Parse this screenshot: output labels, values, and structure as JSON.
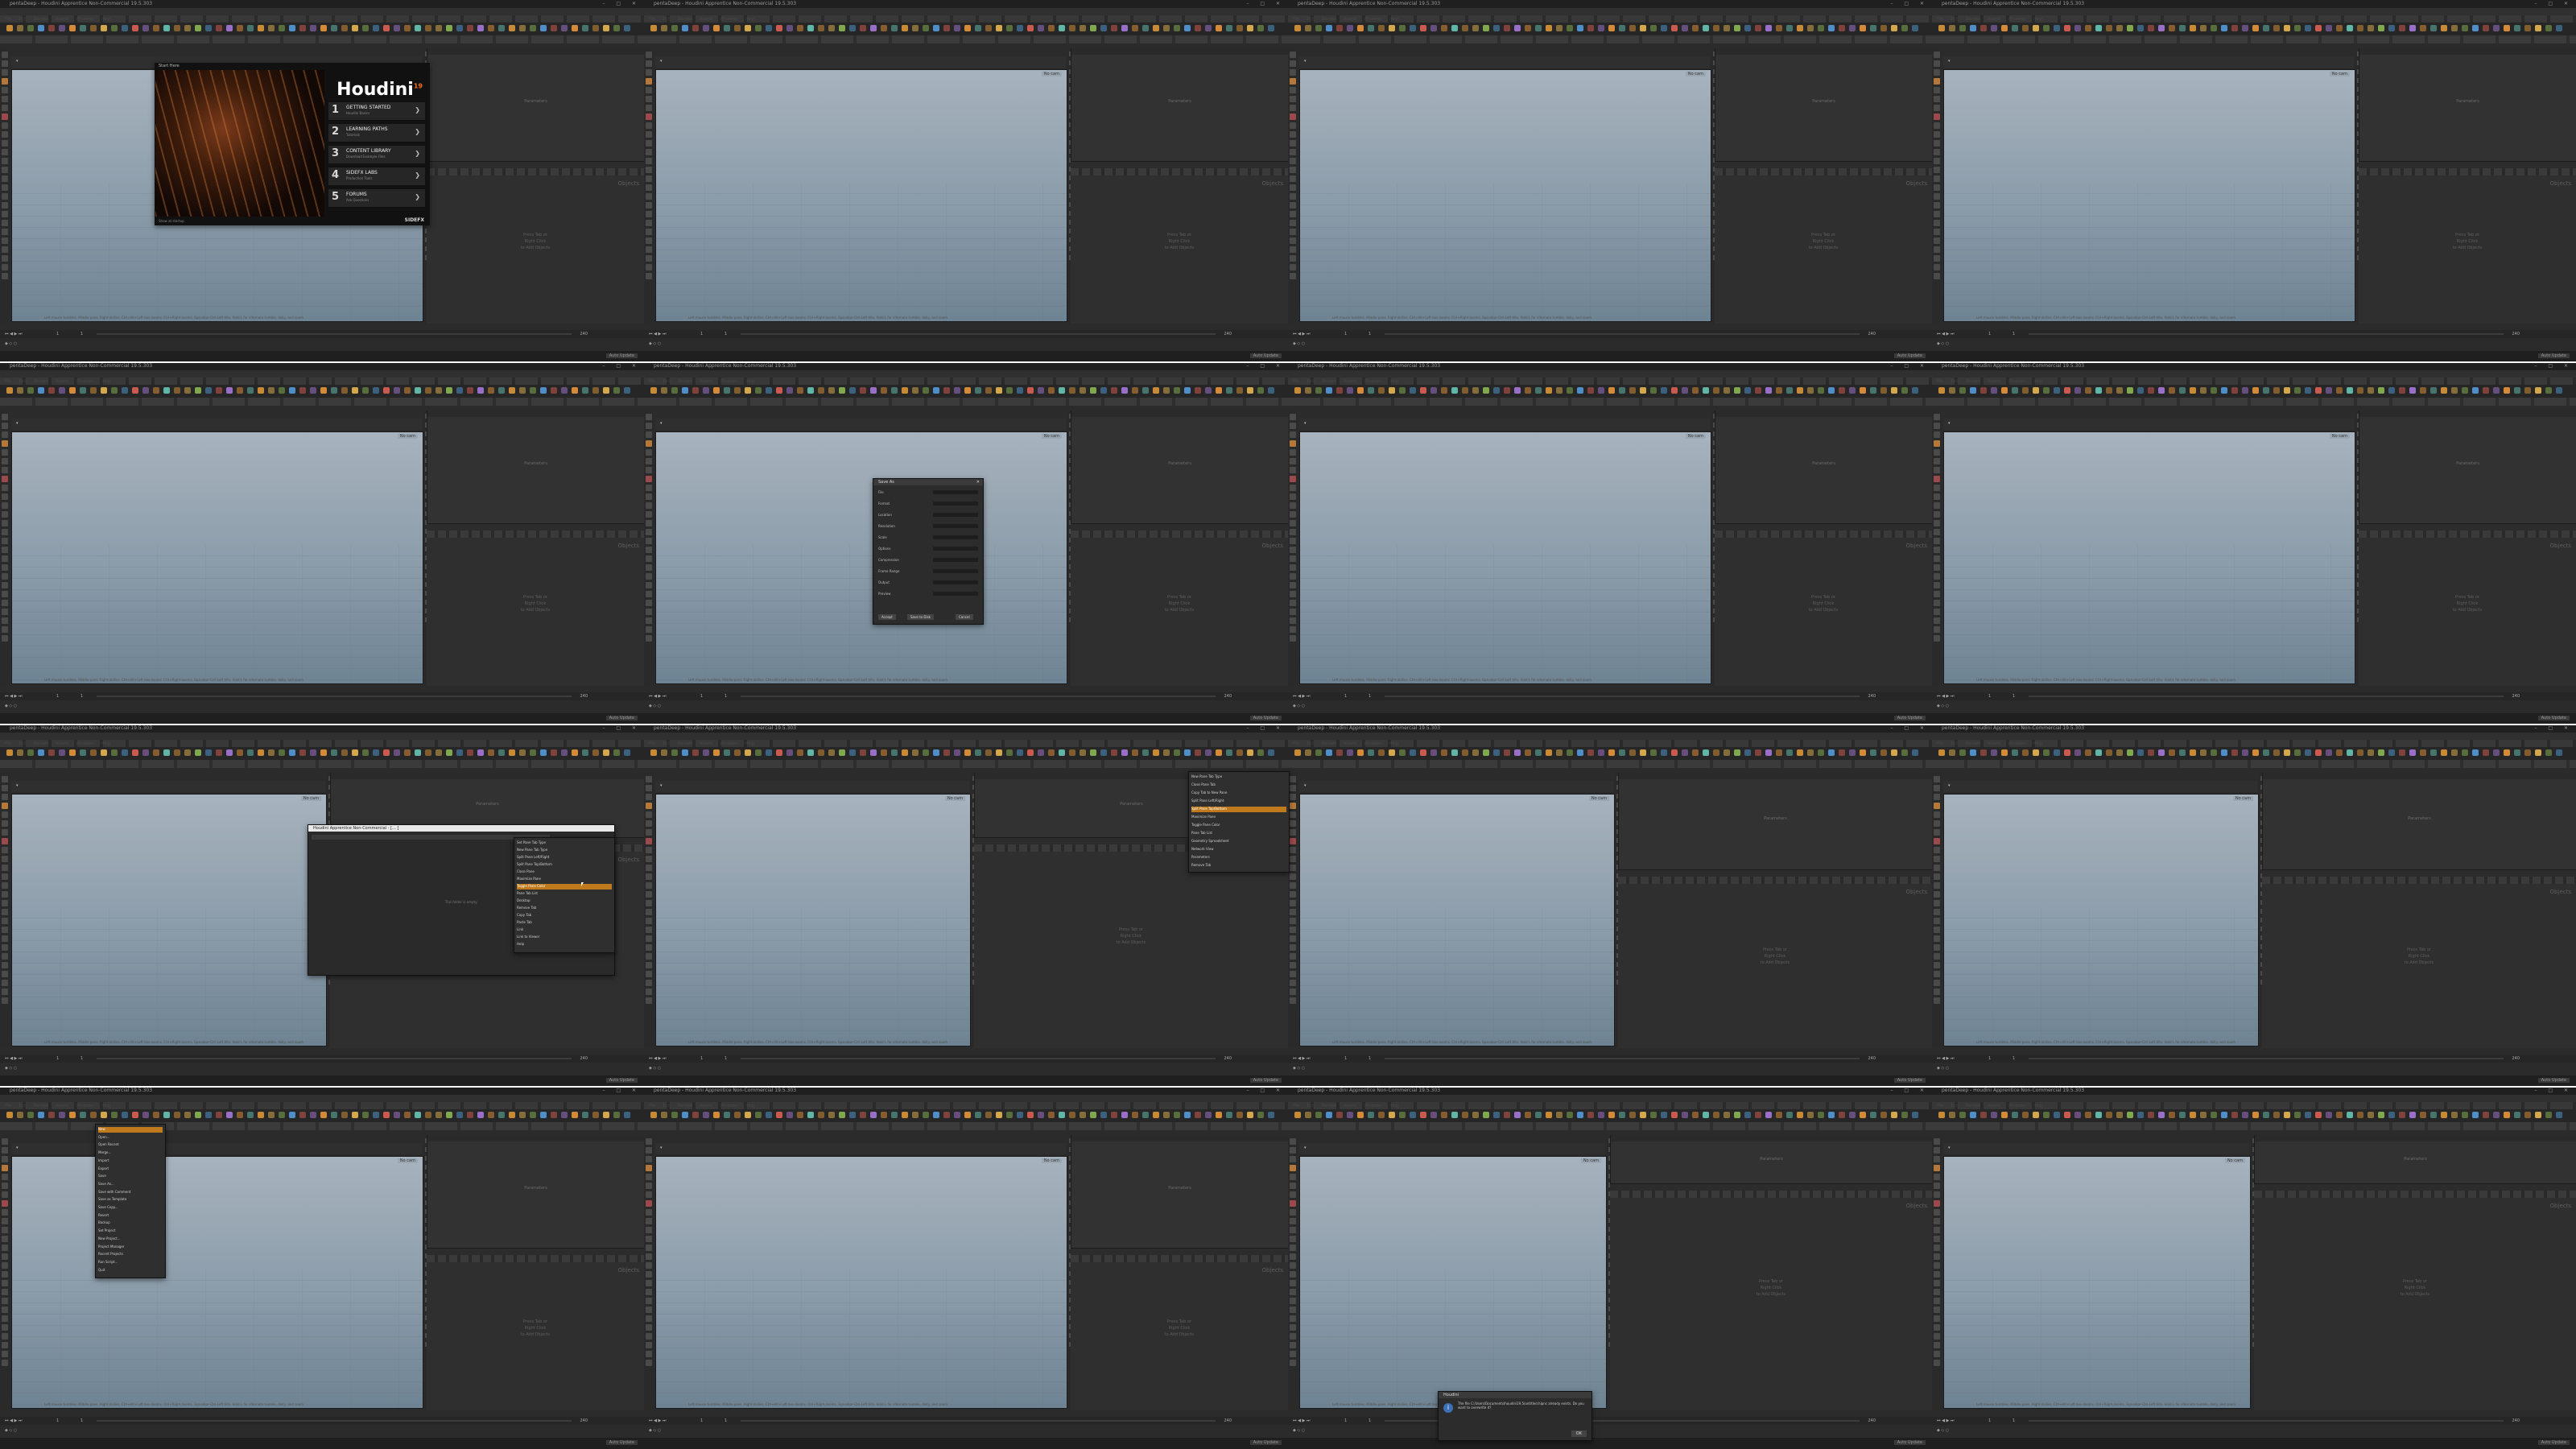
{
  "window_title": "pentaDeep - Houdini Apprentice Non-Commercial 19.5.303",
  "menu": [
    "File",
    "Edit",
    "Render",
    "Assets",
    "Windows",
    "Help"
  ],
  "viewport": {
    "camera_label": "No cam",
    "status_text": "Left mouse tumbles. Middle pans. Right dollies. Ctrl+Alt+Left box-zooms. Ctrl+Right zooms. Spacebar-Ctrl-Left tilts. Hold L for alternate tumble, dolly, and zoom."
  },
  "network": {
    "title_top": "Parameters",
    "empty_text_1": "Press Tab or",
    "empty_text_2": "Right Click",
    "empty_text_3": "to Add Objects",
    "label": "Objects"
  },
  "timeline": {
    "frame": "1",
    "start": "1",
    "end": "240"
  },
  "status_button": "Auto Update",
  "splash": {
    "header": "Start Here",
    "brand": "Houdini",
    "version": "19",
    "items": [
      {
        "num": "1",
        "label": "GETTING STARTED",
        "sub": "Houdini Basics"
      },
      {
        "num": "2",
        "label": "LEARNING PATHS",
        "sub": "Tutorials"
      },
      {
        "num": "3",
        "label": "CONTENT LIBRARY",
        "sub": "Download Example Files"
      },
      {
        "num": "4",
        "label": "SIDEFX LABS",
        "sub": "Production Tools"
      },
      {
        "num": "5",
        "label": "FORUMS",
        "sub": "Ask Questions"
      }
    ],
    "footer": "Show at startup",
    "company": "SIDEFX"
  },
  "dialog": {
    "title": "Save As",
    "rows": [
      "File",
      "Format",
      "Location",
      "Resolution",
      "Scale",
      "Options",
      "Compression",
      "Frame Range",
      "Output",
      "Preview"
    ],
    "buttons": [
      "Accept",
      "Save to Disk",
      "Cancel"
    ]
  },
  "explorer": {
    "title": "Houdini Apprentice Non-Commercial - [... ]",
    "empty": "This folder is empty."
  },
  "context_menu_1": [
    "Set Pane Tab Type",
    "New Pane Tab Type",
    "Split Pane Left/Right",
    "Split Pane Top/Bottom",
    "Close Pane",
    "Maximize Pane",
    "Toggle Pane Color",
    "Pane Tab List",
    "Desktop",
    "Remove Tab",
    "Copy Tab",
    "Paste Tab",
    "Link",
    "Link to Viewer",
    "Help"
  ],
  "context_menu_2": [
    "New Pane Tab Type",
    "Close Pane Tab",
    "Copy Tab to New Pane",
    "Split Pane Left/Right",
    "Split Pane Top/Bottom",
    "Maximize Pane",
    "Toggle Pane Color",
    "Pane Tab List",
    "Geometry Spreadsheet",
    "Network View",
    "Parameters",
    "Remove Tab"
  ],
  "menu_dropdown": [
    "New",
    "Open...",
    "Open Recent",
    "Merge...",
    "Import",
    "Export",
    "Save",
    "Save As...",
    "Save with Comment",
    "Save as Template",
    "Save Copy...",
    "Revert",
    "Backup",
    "Set Project",
    "New Project...",
    "Project Manager",
    "Recent Projects",
    "Run Script...",
    "Quit"
  ],
  "notice": {
    "title": "Houdini",
    "message": "The file C:/Users/Documents/houdini19.5/untitled.hipnc already exists. Do you want to overwrite it?",
    "ok": "OK"
  }
}
